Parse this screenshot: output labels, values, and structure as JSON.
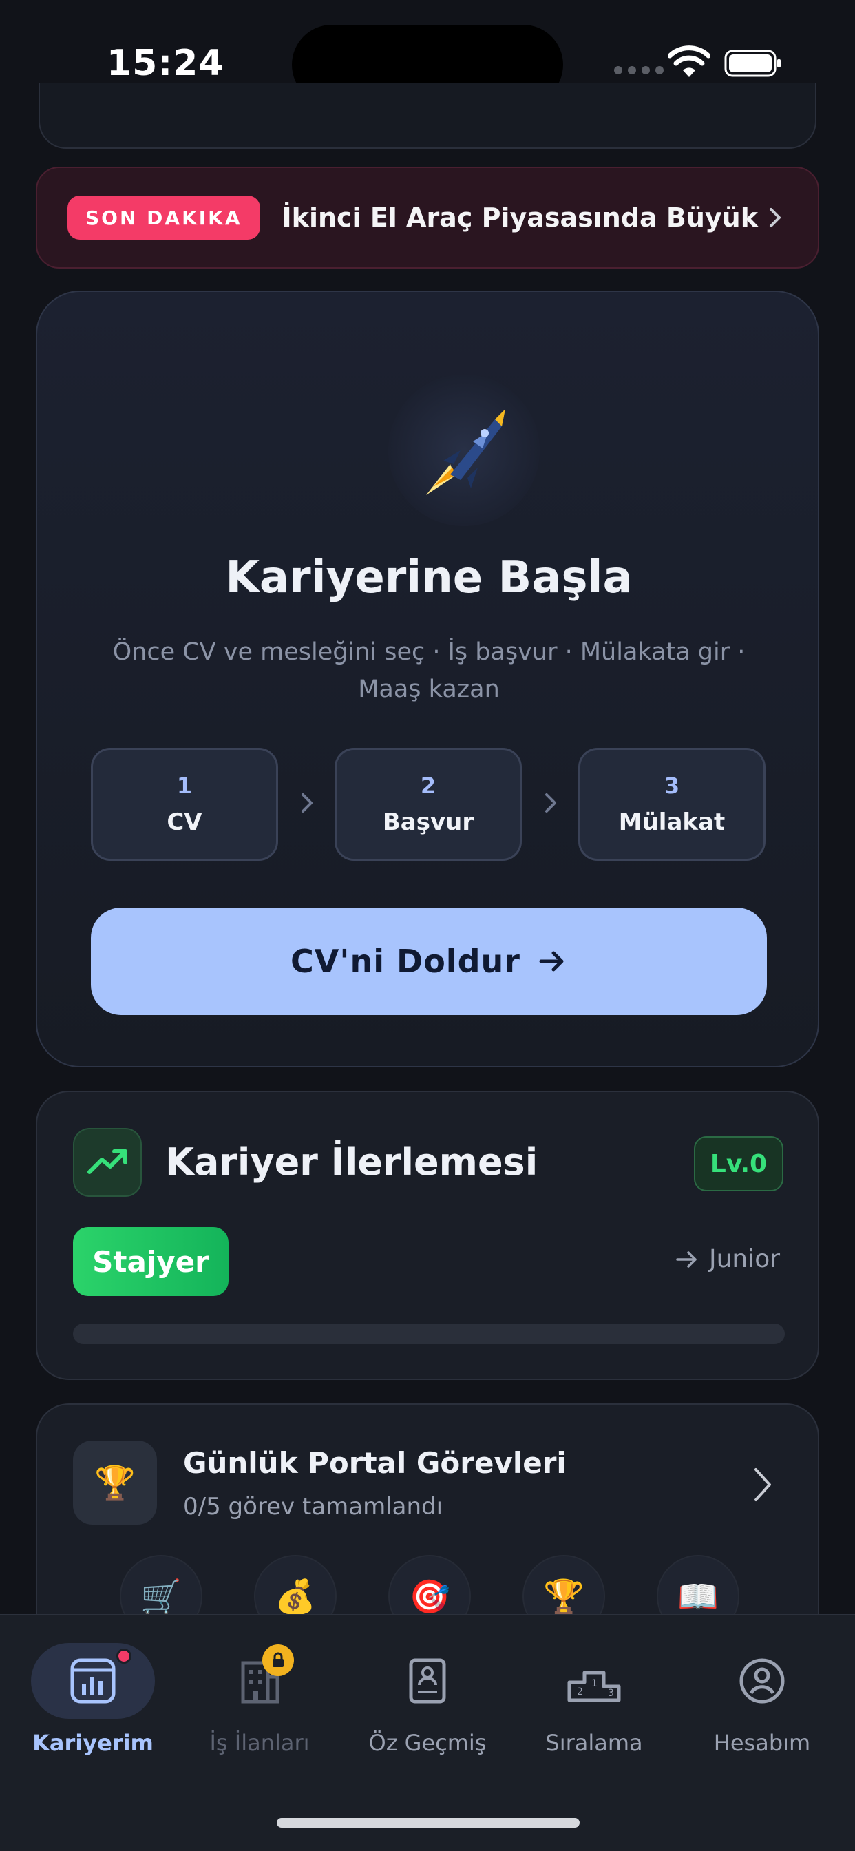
{
  "status_bar": {
    "time": "15:24"
  },
  "news": {
    "badge": "SON DAKIKA",
    "headline": "İkinci El Araç Piyasasında Büyük ..."
  },
  "start_card": {
    "title": "Kariyerine Başla",
    "subtitle": "Önce CV ve mesleğini seç · İş başvur · Mülakata gir · Maaş kazan",
    "steps": [
      {
        "num": "1",
        "label": "CV"
      },
      {
        "num": "2",
        "label": "Başvur"
      },
      {
        "num": "3",
        "label": "Mülakat"
      }
    ],
    "cta_label": "CV'ni Doldur"
  },
  "progress": {
    "title": "Kariyer İlerlemesi",
    "level": "Lv.0",
    "current_rank": "Stajyer",
    "next_rank": "Junior",
    "fraction": 0
  },
  "tasks": {
    "title": "Günlük Portal Görevleri",
    "subtitle": "0/5 görev tamamlandı",
    "icons": [
      "🛒",
      "💰",
      "🎯",
      "🏆",
      "📖"
    ]
  },
  "nav": {
    "items": [
      {
        "label": "Kariyerim",
        "icon": "chart-icon"
      },
      {
        "label": "İş İlanları",
        "icon": "building-icon"
      },
      {
        "label": "Öz Geçmiş",
        "icon": "resume-icon"
      },
      {
        "label": "Sıralama",
        "icon": "podium-icon"
      },
      {
        "label": "Hesabım",
        "icon": "user-icon"
      }
    ]
  },
  "colors": {
    "accent": "#a8c4fd",
    "news_badge": "#f43b67",
    "success": "#2bd36a"
  }
}
